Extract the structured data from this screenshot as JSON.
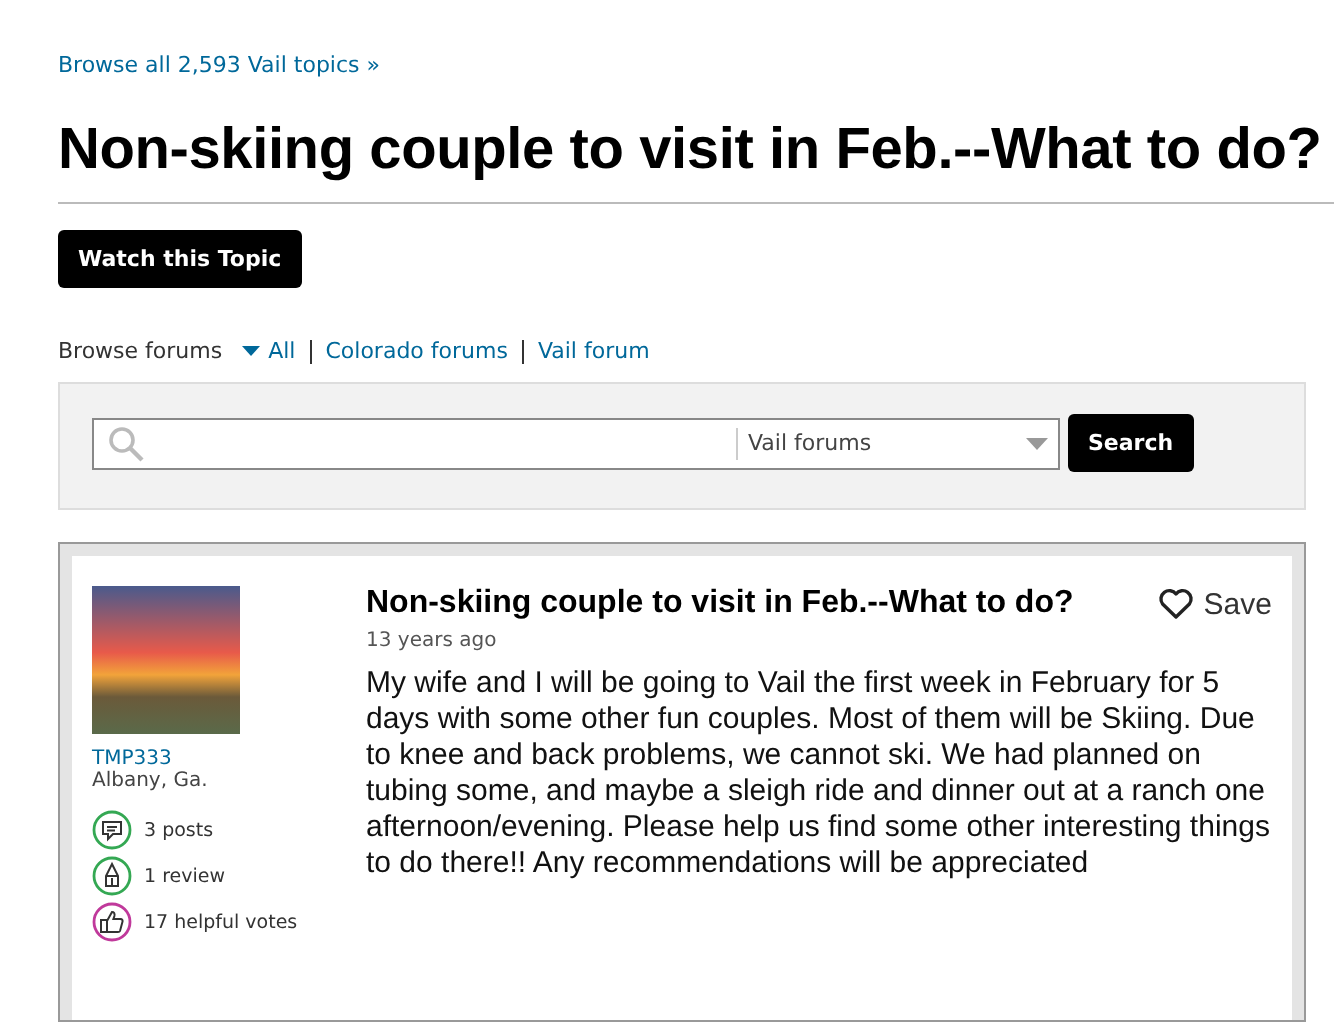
{
  "breadcrumb_link": "Browse all 2,593 Vail topics »",
  "title": "Non-skiing couple to visit in Feb.--What to do?",
  "watch_button": "Watch this Topic",
  "browse_forums": {
    "label": "Browse forums",
    "links": [
      "All",
      "Colorado forums",
      "Vail forum"
    ]
  },
  "search": {
    "scope": "Vail forums",
    "button": "Search"
  },
  "post": {
    "author": "TMP333",
    "location": "Albany, Ga.",
    "stats": [
      {
        "kind": "posts",
        "label": "3 posts",
        "color": "#34a853"
      },
      {
        "kind": "reviews",
        "label": "1 review",
        "color": "#34a853"
      },
      {
        "kind": "votes",
        "label": "17 helpful votes",
        "color": "#c0399b"
      }
    ],
    "title": "Non-skiing couple to visit in Feb.--What to do?",
    "save": "Save",
    "time": "13 years ago",
    "body": "My wife and I will be going to Vail the first week in February for 5 days with some other fun couples. Most of them will be Skiing. Due to knee and back problems, we cannot ski. We had planned on tubing some, and maybe a sleigh ride and dinner out at a ranch one afternoon/evening. Please help us find some other interesting things to do there!! Any recommendations will be appreciated"
  }
}
